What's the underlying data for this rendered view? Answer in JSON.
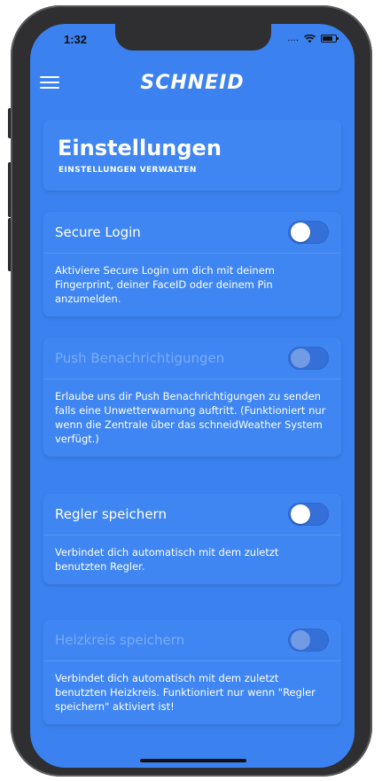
{
  "status_bar": {
    "time": "1:32",
    "signal": "....",
    "wifi_icon": "wifi-icon",
    "battery_icon": "battery-icon"
  },
  "topbar": {
    "menu_icon": "hamburger-icon",
    "logo": "SCHNEID"
  },
  "header": {
    "title": "Einstellungen",
    "subtitle": "EINSTELLUNGEN VERWALTEN"
  },
  "settings": [
    {
      "title": "Secure Login",
      "enabled": true,
      "toggle_on": false,
      "description": "Aktiviere Secure Login um dich mit deinem Fingerprint, deiner FaceID oder deinem Pin anzumelden."
    },
    {
      "title": "Push Benachrichtigungen",
      "enabled": false,
      "toggle_on": false,
      "description": "Erlaube uns dir Push Benachrichtigungen zu senden falls eine Unwetterwarnung auftritt. (Funktioniert nur wenn die Zentrale über das schneidWeather System verfügt.)"
    },
    {
      "title": "Regler speichern",
      "enabled": true,
      "toggle_on": false,
      "description": "Verbindet dich automatisch mit dem zuletzt benutzten Regler."
    },
    {
      "title": "Heizkreis speichern",
      "enabled": false,
      "toggle_on": false,
      "description": "Verbindet dich automatisch mit dem zuletzt benutzten Heizkreis. Funktioniert nur wenn \"Regler speichern\" aktiviert ist!"
    }
  ],
  "colors": {
    "background": "#3b82f0",
    "card": "#3f86f2",
    "toggle_track": "#3470d8",
    "text": "#ffffff"
  }
}
